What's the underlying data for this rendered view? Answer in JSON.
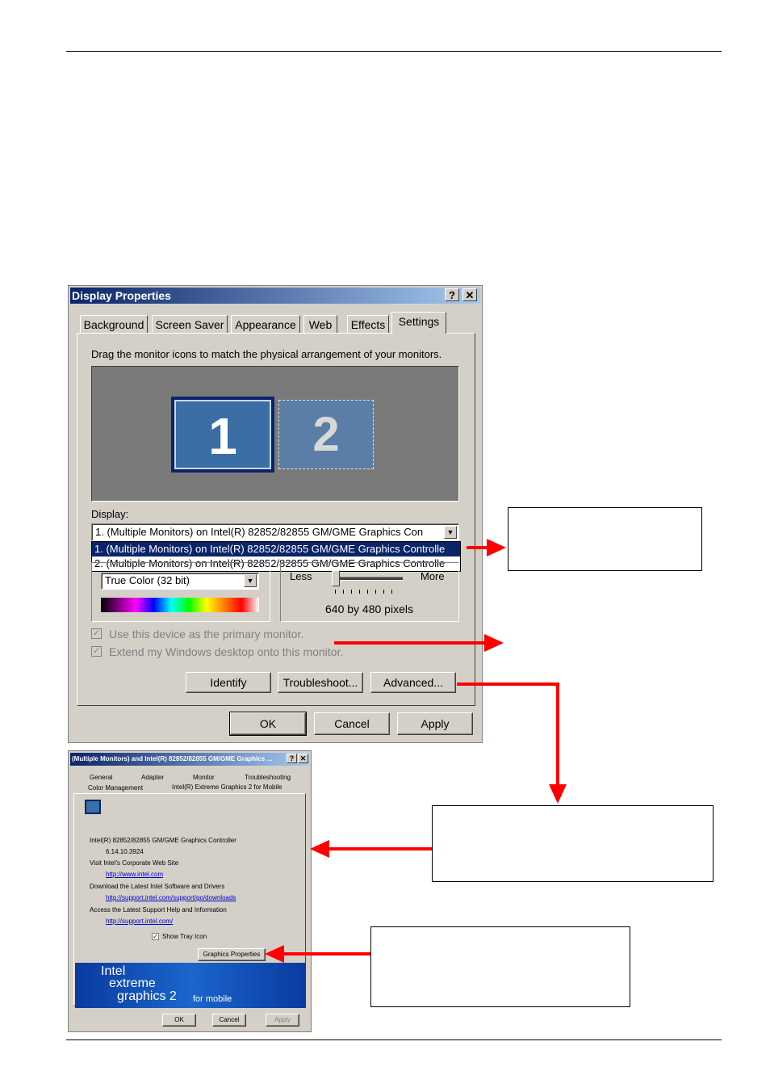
{
  "dialog": {
    "title": "Display Properties",
    "help_glyph": "?",
    "close_glyph": "✕",
    "tabs": [
      "Background",
      "Screen Saver",
      "Appearance",
      "Web",
      "Effects",
      "Settings"
    ],
    "active_tab": "Settings",
    "instruction": "Drag the monitor icons to match the physical arrangement of your monitors.",
    "monitor_1": "1",
    "monitor_2": "2",
    "display_label": "Display:",
    "display_value": "1. (Multiple Monitors) on Intel(R) 82852/82855 GM/GME Graphics Con",
    "display_options": [
      "1. (Multiple Monitors) on Intel(R) 82852/82855 GM/GME Graphics Controlle",
      "2. (Multiple Monitors) on Intel(R) 82852/82855 GM/GME Graphics Controlle"
    ],
    "color_quality_value": "True Color (32 bit)",
    "resolution_less": "Less",
    "resolution_more": "More",
    "resolution_value": "640 by 480 pixels",
    "checkbox_primary": "Use this device as the primary monitor.",
    "checkbox_extend": "Extend my Windows desktop onto this monitor.",
    "buttons": {
      "identify": "Identify",
      "troubleshoot": "Troubleshoot...",
      "advanced": "Advanced...",
      "ok": "OK",
      "cancel": "Cancel",
      "apply": "Apply"
    }
  },
  "advanced_dialog": {
    "title": "(Multiple Monitors) and Intel(R) 82852/82855 GM/GME Graphics ...",
    "tabs_row1": [
      "General",
      "Adapter",
      "Monitor",
      "Troubleshooting"
    ],
    "tabs_row2": [
      "Color Management",
      "Intel(R) Extreme Graphics 2 for Mobile"
    ],
    "controller_name": "Intel(R) 82852/82855 GM/GME Graphics Controller",
    "version": "6.14.10.3924",
    "visit_text": "Visit Intel's Corporate Web Site",
    "visit_link": "http://www.intel.com",
    "download_text": "Download the Latest Intel Software and Drivers",
    "download_link": "http://support.intel.com/support/go/downloads",
    "support_text": "Access the Latest Support Help and Information",
    "support_link": "http://support.intel.com/",
    "show_tray_icon": "Show Tray Icon",
    "graphics_properties": "Graphics Properties",
    "banner_line1": "Intel",
    "banner_line2": "extreme",
    "banner_line3": "graphics 2",
    "banner_line4": "for mobile",
    "buttons": {
      "ok": "OK",
      "cancel": "Cancel",
      "apply": "Apply"
    }
  },
  "colors": {
    "arrow": "#ff0000",
    "titlebar": "#0a246a",
    "monitor": "#3a6ea5"
  }
}
